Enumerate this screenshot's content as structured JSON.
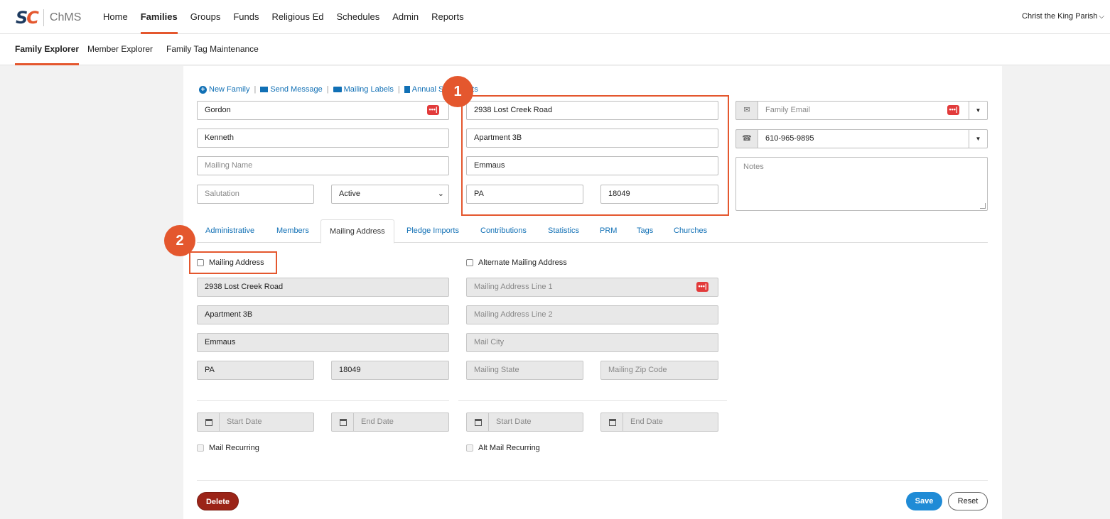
{
  "app": {
    "name": "ChMS",
    "logo_text": "SC",
    "parish": "Christ the King Parish"
  },
  "main_menu": [
    "Home",
    "Families",
    "Groups",
    "Funds",
    "Religious Ed",
    "Schedules",
    "Admin",
    "Reports"
  ],
  "main_menu_active": "Families",
  "sub_menu": [
    "Family Explorer",
    "Member Explorer",
    "Family Tag Maintenance"
  ],
  "sub_menu_active": "Family Explorer",
  "actions": {
    "new_family": "New Family",
    "send_message": "Send Message",
    "mailing_labels": "Mailing Labels",
    "annual_statements": "Annual Statements"
  },
  "family": {
    "last_name": "Gordon",
    "first_name": "Kenneth",
    "mailing_name_placeholder": "Mailing Name",
    "salutation_placeholder": "Salutation",
    "status": "Active",
    "address1": "2938 Lost Creek Road",
    "address2": "Apartment 3B",
    "city": "Emmaus",
    "state": "PA",
    "zip": "18049",
    "email_placeholder": "Family Email",
    "phone": "610-965-9895",
    "notes_placeholder": "Notes"
  },
  "tabs": [
    "Administrative",
    "Members",
    "Mailing Address",
    "Pledge Imports",
    "Contributions",
    "Statistics",
    "PRM",
    "Tags",
    "Churches"
  ],
  "tab_active": "Mailing Address",
  "mailing": {
    "primary_label": "Mailing Address",
    "alternate_label": "Alternate Mailing Address",
    "primary": {
      "line1": "2938 Lost Creek Road",
      "line2": "Apartment 3B",
      "city": "Emmaus",
      "state": "PA",
      "zip": "18049"
    },
    "alternate_placeholders": {
      "line1": "Mailing Address Line 1",
      "line2": "Mailing Address Line 2",
      "city": "Mail City",
      "state": "Mailing State",
      "zip": "Mailing Zip Code"
    },
    "start_date_placeholder": "Start Date",
    "end_date_placeholder": "End Date",
    "mail_recurring": "Mail Recurring",
    "alt_mail_recurring": "Alt Mail Recurring"
  },
  "buttons": {
    "delete": "Delete",
    "save": "Save",
    "reset": "Reset"
  },
  "annotations": {
    "badge1": "1",
    "badge2": "2",
    "color": "#e4572e"
  },
  "icons": {
    "lastpass": "•••|",
    "email": "envelope-icon",
    "phone": "phone-icon",
    "calendar": "calendar-icon"
  }
}
